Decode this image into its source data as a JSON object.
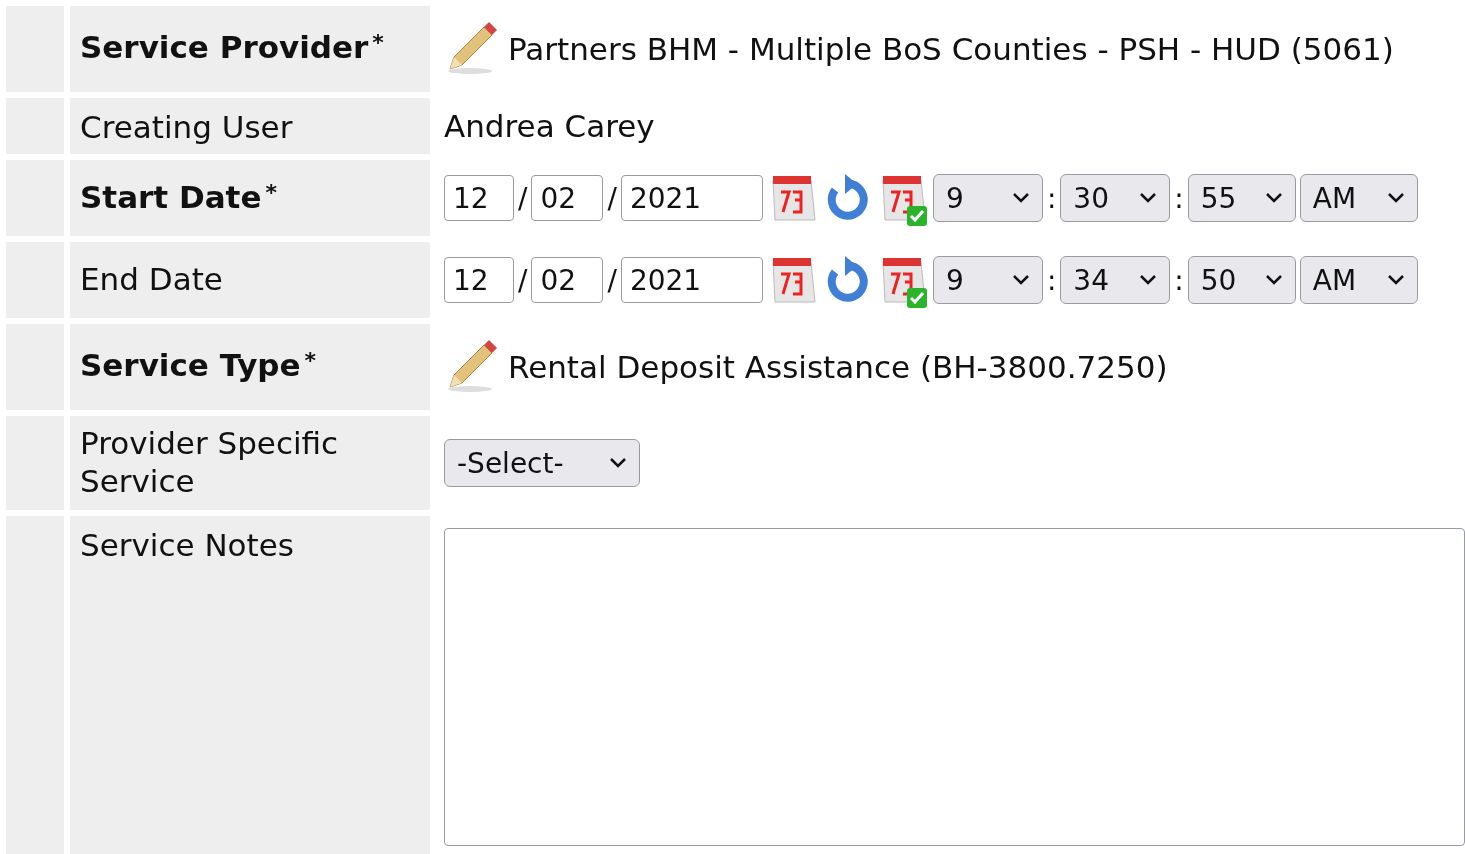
{
  "rows": [
    {
      "kind": "edit",
      "label": "Service Provider",
      "required": true,
      "mark": "*",
      "value": "Partners BHM - Multiple BoS Counties - PSH - HUD (5061)"
    },
    {
      "kind": "text",
      "label": "Creating User",
      "required": false,
      "value": "Andrea Carey"
    },
    {
      "kind": "date",
      "label": "Start Date",
      "required": true,
      "mark": "*",
      "month": "12",
      "day": "02",
      "year": "2021",
      "date_separator": "/",
      "hour": "9",
      "minute": "30",
      "second": "55",
      "ampm": "AM",
      "time_separator": ":"
    },
    {
      "kind": "date",
      "label": "End Date",
      "required": false,
      "month": "12",
      "day": "02",
      "year": "2021",
      "date_separator": "/",
      "hour": "9",
      "minute": "34",
      "second": "50",
      "ampm": "AM",
      "time_separator": ":"
    },
    {
      "kind": "edit",
      "label": "Service Type",
      "required": true,
      "mark": "*",
      "value": "Rental Deposit Assistance (BH-3800.7250)"
    },
    {
      "kind": "select",
      "label": "Provider Specific Service",
      "required": false,
      "value": "-Select-"
    },
    {
      "kind": "textarea",
      "label": "Service Notes",
      "required": false
    }
  ]
}
